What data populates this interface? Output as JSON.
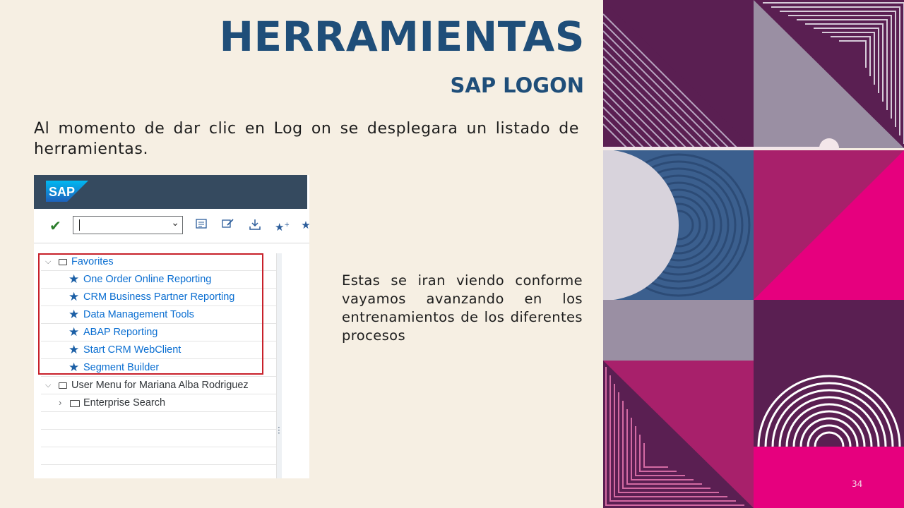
{
  "slide": {
    "title": "HERRAMIENTAS",
    "subtitle": "SAP LOGON",
    "intro": "Al momento de dar clic en Log on se desplegara un listado de herramientas.",
    "side_text": "Estas se iran viendo conforme vayamos avanzando en los entrenamientos de los diferentes procesos",
    "page_number": "34"
  },
  "sap": {
    "logo_text": "SAP",
    "command_field_value": "",
    "tree": {
      "favorites_label": "Favorites",
      "favorites": [
        "One Order Online Reporting",
        "CRM Business Partner Reporting",
        "Data Management Tools",
        "ABAP Reporting",
        "Start CRM WebClient",
        "Segment Builder"
      ],
      "user_menu_label": "User Menu for Mariana Alba Rodriguez",
      "enterprise_search_label": "Enterprise Search"
    }
  },
  "colors": {
    "title": "#1f4e79",
    "background": "#f6efe3",
    "sap_header": "#354a5f",
    "highlight_box": "#c8202a",
    "link": "#0a6ed1",
    "deco_purple": "#5a1f52",
    "deco_magenta": "#e6007e",
    "deco_blue": "#3b5f8e",
    "deco_gray": "#9a8fa3"
  }
}
